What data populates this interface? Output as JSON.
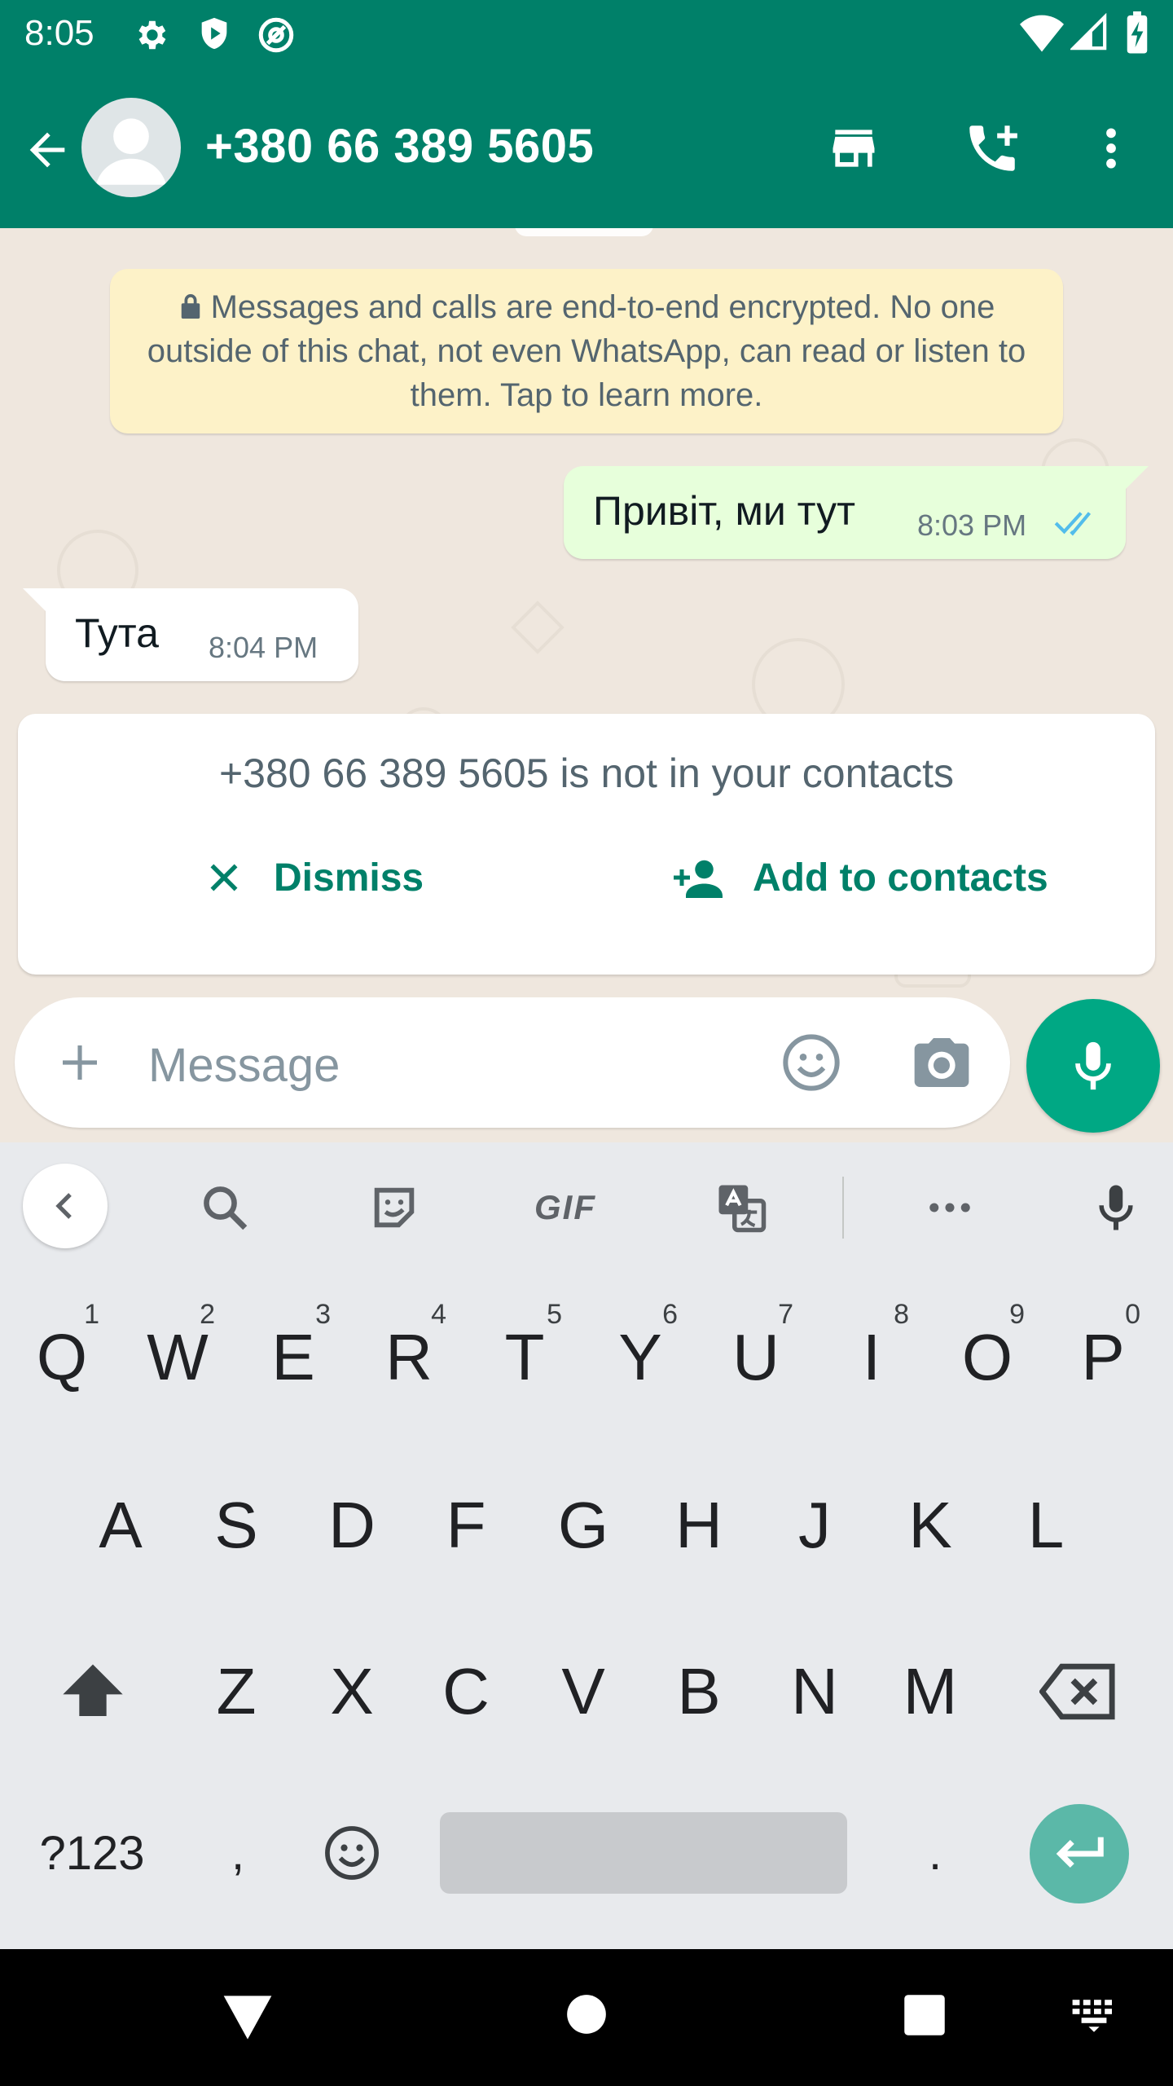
{
  "status_bar": {
    "time": "8:05",
    "icons": [
      "settings-icon",
      "shield-icon",
      "at-sign-icon",
      "wifi-icon",
      "signal-icon",
      "battery-charging-icon"
    ]
  },
  "app_bar": {
    "title": "+380 66 389 5605",
    "color": "#008069",
    "icons": [
      "back-arrow-icon",
      "avatar",
      "store-icon",
      "add-call-icon",
      "more-vert-icon"
    ]
  },
  "chat": {
    "encryption_notice": "Messages and calls are end-to-end encrypted. No one outside of this chat, not even WhatsApp, can read or listen to them. Tap to learn more.",
    "messages": [
      {
        "direction": "outgoing",
        "text": "Привіт, ми тут",
        "time": "8:03 PM",
        "status": "read"
      },
      {
        "direction": "incoming",
        "text": "Тута",
        "time": "8:04 PM"
      }
    ],
    "contact_card": {
      "message": "+380 66 389 5605 is not in your contacts",
      "dismiss_label": "Dismiss",
      "add_label": "Add to contacts"
    }
  },
  "composer": {
    "placeholder": "Message",
    "accent": "#00a884"
  },
  "keyboard": {
    "toolbar": [
      "back-chevron-icon",
      "search-icon",
      "sticker-icon",
      "gif-icon",
      "translate-icon",
      "more-horiz-icon",
      "voice-input-icon"
    ],
    "gif_label": "GIF",
    "row1": [
      {
        "k": "Q",
        "h": "1"
      },
      {
        "k": "W",
        "h": "2"
      },
      {
        "k": "E",
        "h": "3"
      },
      {
        "k": "R",
        "h": "4"
      },
      {
        "k": "T",
        "h": "5"
      },
      {
        "k": "Y",
        "h": "6"
      },
      {
        "k": "U",
        "h": "7"
      },
      {
        "k": "I",
        "h": "8"
      },
      {
        "k": "O",
        "h": "9"
      },
      {
        "k": "P",
        "h": "0"
      }
    ],
    "row2": [
      "A",
      "S",
      "D",
      "F",
      "G",
      "H",
      "J",
      "K",
      "L"
    ],
    "row3": [
      "Z",
      "X",
      "C",
      "V",
      "B",
      "N",
      "M"
    ],
    "symbols_label": "?123",
    "comma": ",",
    "period": "."
  },
  "nav_bar": {
    "icons": [
      "back-triangle-icon",
      "home-circle-icon",
      "recents-square-icon",
      "keyboard-switch-icon"
    ]
  }
}
